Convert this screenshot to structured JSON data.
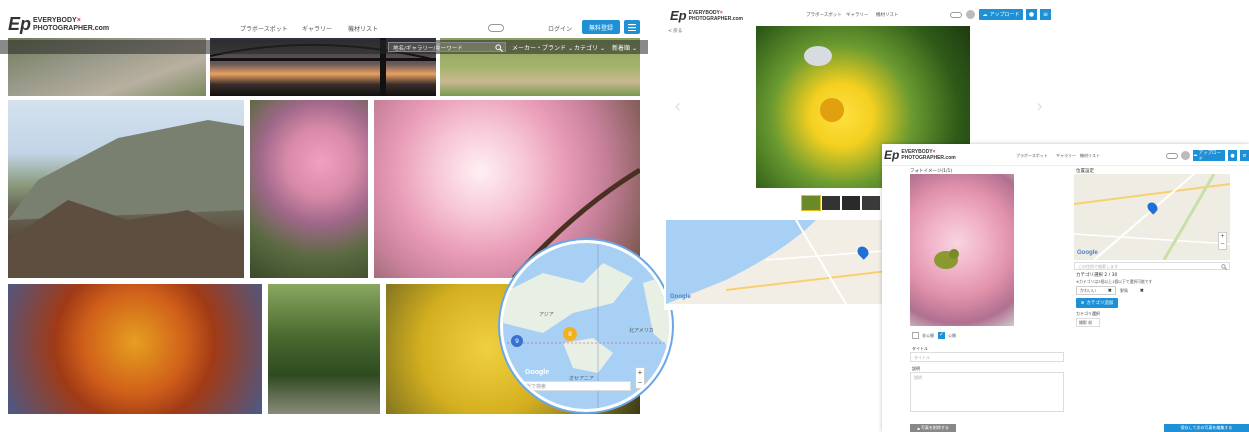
{
  "panel1": {
    "logo": {
      "mark": "Ep",
      "line1": "EVERYBODY",
      "x": "×",
      "line2": "PHOTOGRAPHER.com"
    },
    "nav": [
      "プラボースポット",
      "ギャラリー",
      "機材リスト"
    ],
    "login": "ログイン",
    "signup": "無料登録",
    "searchbar": {
      "placeholder": "地名/ギャラリー/キーワード",
      "maker": "メーカー・ブランド",
      "category": "カテゴリ",
      "sort": "新着順"
    },
    "map": {
      "marker_count_a": "8",
      "marker_count_b": "9",
      "label_asia": "アジア",
      "label_oceania": "オセアニア",
      "label_na": "北アメリカ",
      "google": "Google",
      "search_placeholder": "場所で検索"
    }
  },
  "panel2": {
    "logo": {
      "mark": "Ep",
      "line1": "EVERYBODY",
      "x": "×",
      "line2": "PHOTOGRAPHER.com"
    },
    "nav": [
      "プラボースポット",
      "ギャラリー",
      "機材リスト"
    ],
    "upload": "アップロード",
    "back": "< 戻る",
    "google": "Google"
  },
  "panel3": {
    "logo": {
      "mark": "Ep",
      "line1": "EVERYBODY",
      "x": "×",
      "line2": "PHOTOGRAPHER.com"
    },
    "nav": [
      "プラボースポット",
      "ギャラリー",
      "機材リスト"
    ],
    "upload": "アップロード",
    "photo_label": "フォトイメージ(1/1)",
    "location_label": "位置設定",
    "location_placeholder": "この住所で検索します",
    "category_label": "カテゴリ選択 2 / 30",
    "category_note": "※カテゴリは3個以上1個以下で選択可能です",
    "tags": [
      "かわいい",
      "野鳥"
    ],
    "add_category": "カテゴリ追加",
    "maker_label": "カテゴリ選択",
    "maker_value": "撮影 前",
    "radio_private": "非公開",
    "radio_public": "公開",
    "title_label": "タイトル",
    "title_placeholder": "タイトル",
    "desc_label": "説明",
    "desc_placeholder": "説明",
    "delete_btn": "写真を削除する",
    "save_btn": "保存して次の写真を編集する",
    "google": "Google"
  }
}
